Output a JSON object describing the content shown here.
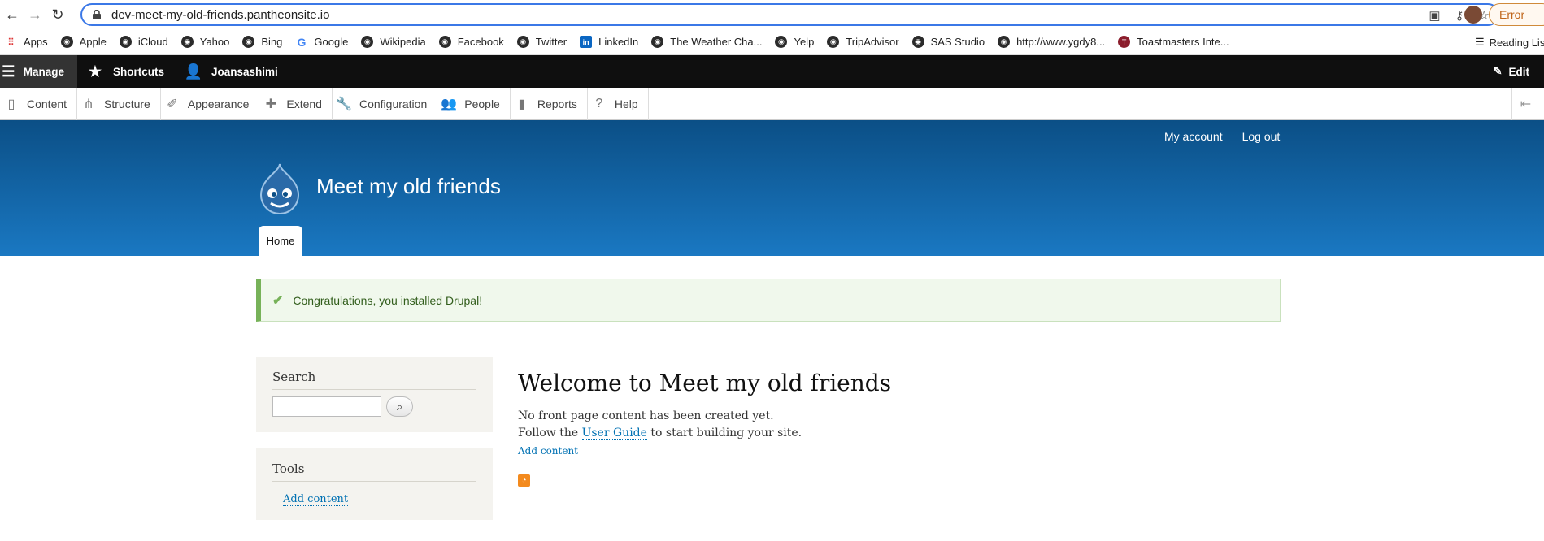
{
  "browser": {
    "url": "dev-meet-my-old-friends.pantheonsite.io",
    "error_label": "Error",
    "bookmarks": [
      "Apps",
      "Apple",
      "iCloud",
      "Yahoo",
      "Bing",
      "Google",
      "Wikipedia",
      "Facebook",
      "Twitter",
      "LinkedIn",
      "The Weather Cha...",
      "Yelp",
      "TripAdvisor",
      "SAS Studio",
      "http://www.ygdy8...",
      "Toastmasters Inte..."
    ],
    "reading_list": "Reading List"
  },
  "toolbar": {
    "manage": "Manage",
    "shortcuts": "Shortcuts",
    "user": "Joansashimi",
    "edit": "Edit"
  },
  "tray": {
    "items": [
      "Content",
      "Structure",
      "Appearance",
      "Extend",
      "Configuration",
      "People",
      "Reports",
      "Help"
    ]
  },
  "header": {
    "my_account": "My account",
    "log_out": "Log out",
    "site_name": "Meet my old friends",
    "home_tab": "Home"
  },
  "message": "Congratulations, you installed Drupal!",
  "sidebar": {
    "search_title": "Search",
    "tools_title": "Tools",
    "tools_link": "Add content"
  },
  "main": {
    "title": "Welcome to Meet my old friends",
    "line1": "No front page content has been created yet.",
    "line2_pre": "Follow the",
    "line2_link": "User Guide",
    "line2_post": "to start building your site.",
    "add_content": "Add content"
  },
  "colors": {
    "header_top": "#0b4f86",
    "header_bottom": "#1a78c2",
    "status_green": "#77b259",
    "link": "#0071b3"
  }
}
